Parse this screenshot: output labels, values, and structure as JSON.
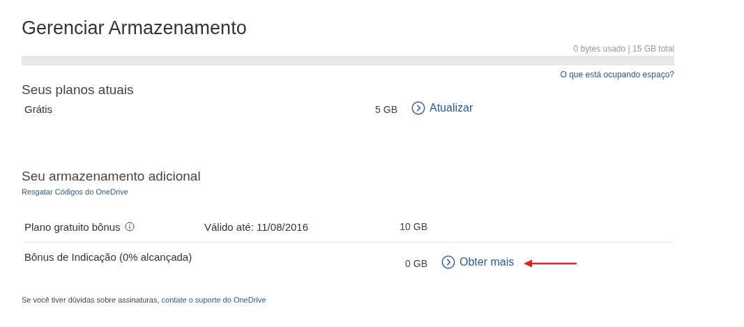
{
  "title": "Gerenciar Armazenamento",
  "usage": {
    "text": "0 bytes usado | 15 GB total",
    "level": 0,
    "link": "O que está ocupando espaço?"
  },
  "current_plans": {
    "heading": "Seus planos atuais",
    "rows": [
      {
        "name": "Grátis",
        "amount": "5 GB",
        "action": "Atualizar"
      }
    ]
  },
  "additional": {
    "heading": "Seu armazenamento adicional",
    "link": "Resgatar Códigos do OneDrive",
    "rows": [
      {
        "kind": "info",
        "name": "Plano gratuito bônus",
        "validity": "Válido até: 11/08/2016",
        "amount": "10 GB"
      },
      {
        "kind": "action",
        "name": "Bônus de Indicação (0% alcançada)",
        "amount": "0 GB",
        "action": "Obter mais"
      }
    ]
  },
  "footer": {
    "text": "Se você tiver dúvidas sobre assinaturas,",
    "link": "contate o suporte do OneDrive"
  }
}
